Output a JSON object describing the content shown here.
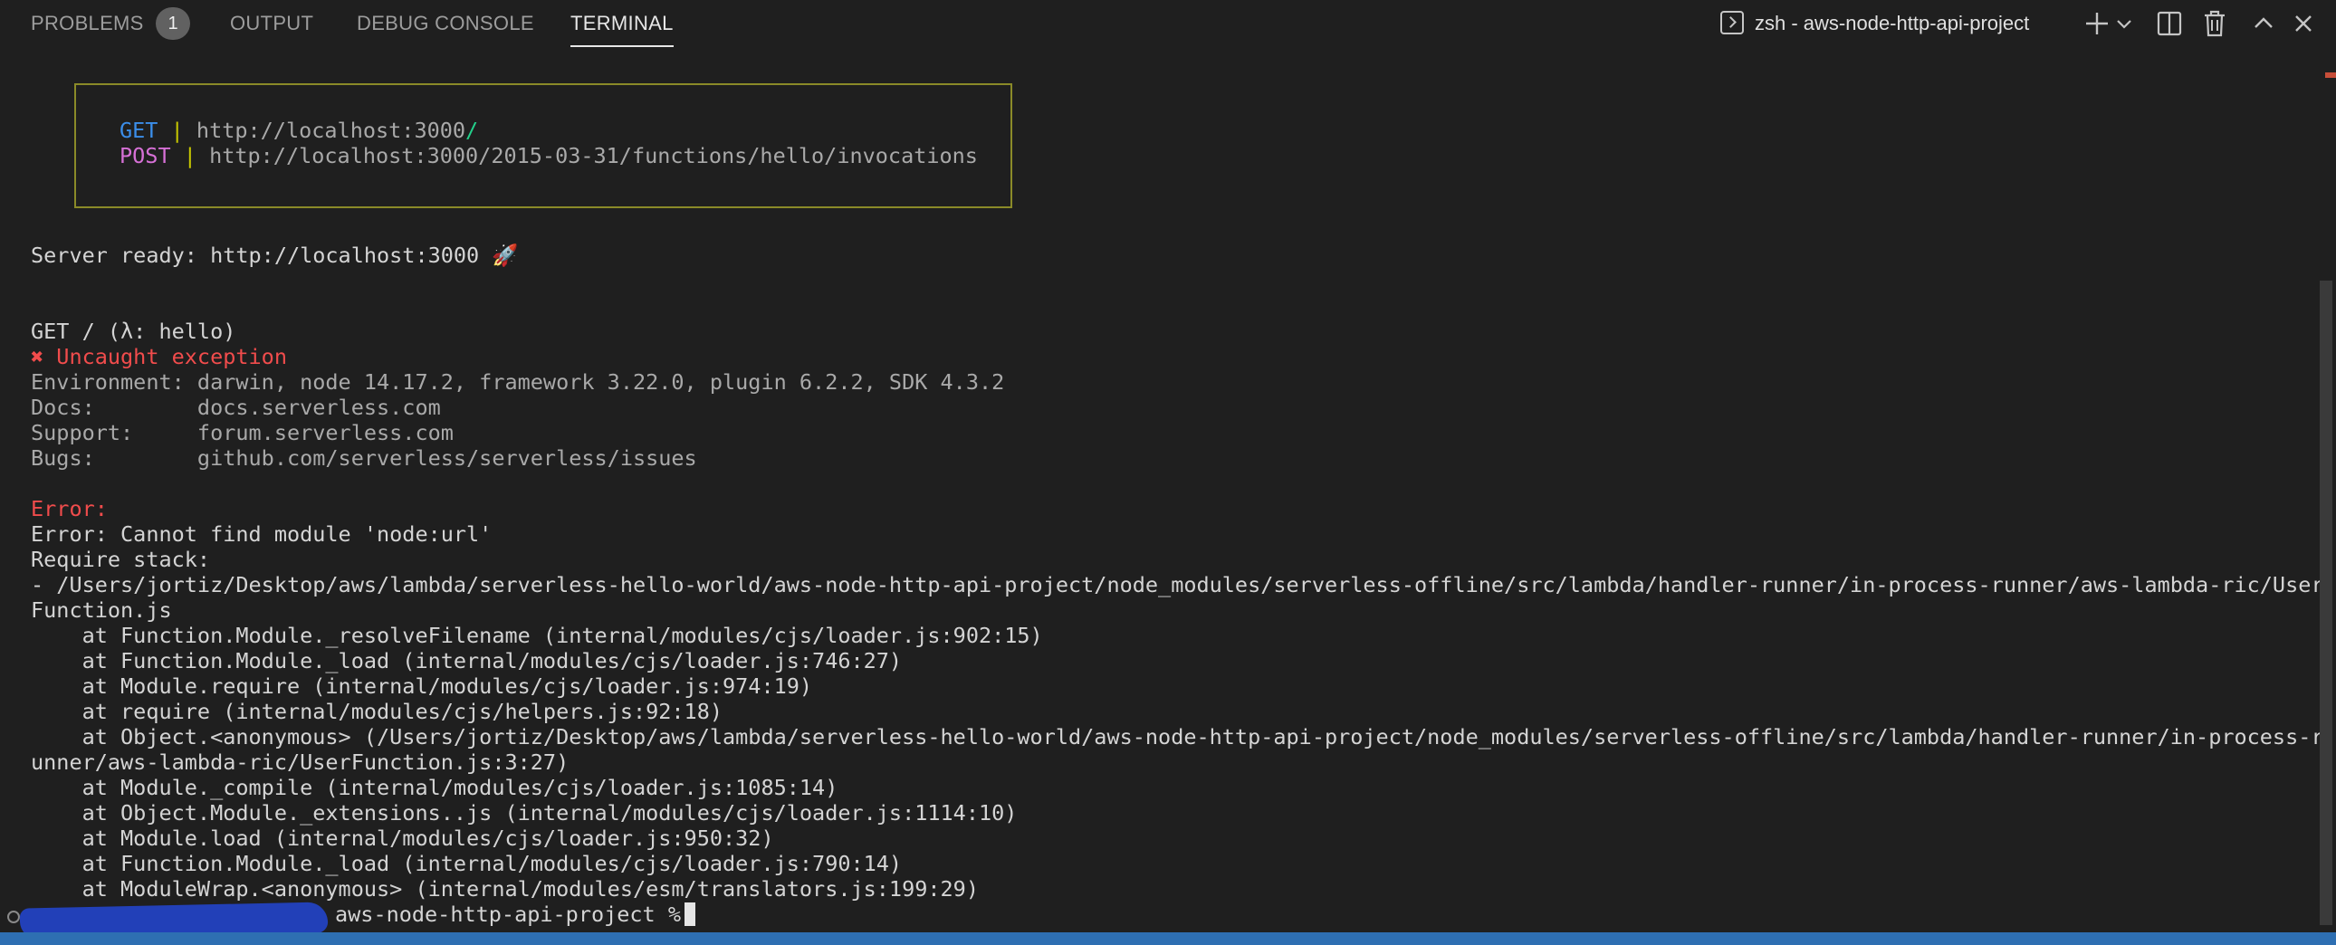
{
  "panel": {
    "tabs": [
      "PROBLEMS",
      "OUTPUT",
      "DEBUG CONSOLE",
      "TERMINAL"
    ],
    "problems_count": "1",
    "terminal_name": "zsh - aws-node-http-api-project"
  },
  "routes": {
    "get_method": "GET",
    "get_url": "http://localhost:3000",
    "get_slash": "/",
    "post_method": "POST",
    "post_url": "http://localhost:3000/2015-03-31/functions/hello/invocations",
    "separator": "|"
  },
  "output": {
    "server_ready": "Server ready: http://localhost:3000 🚀",
    "request": "GET / (λ: hello)",
    "uncaught": "✖ Uncaught exception",
    "environment": "Environment: darwin, node 14.17.2, framework 3.22.0, plugin 6.2.2, SDK 4.3.2",
    "docs": "Docs:        docs.serverless.com",
    "support": "Support:     forum.serverless.com",
    "bugs": "Bugs:        github.com/serverless/serverless/issues",
    "error_label": "Error:",
    "error_msg": "Error: Cannot find module 'node:url'",
    "require_stack": "Require stack:",
    "stack_path_1": "- /Users/jortiz/Desktop/aws/lambda/serverless-hello-world/aws-node-http-api-project/node_modules/serverless-offline/src/lambda/handler-runner/in-process-runner/aws-lambda-ric/User",
    "stack_path_2": "Function.js",
    "trace": [
      "    at Function.Module._resolveFilename (internal/modules/cjs/loader.js:902:15)",
      "    at Function.Module._load (internal/modules/cjs/loader.js:746:27)",
      "    at Module.require (internal/modules/cjs/loader.js:974:19)",
      "    at require (internal/modules/cjs/helpers.js:92:18)",
      "    at Object.<anonymous> (/Users/jortiz/Desktop/aws/lambda/serverless-hello-world/aws-node-http-api-project/node_modules/serverless-offline/src/lambda/handler-runner/in-process-r",
      "unner/aws-lambda-ric/UserFunction.js:3:27)",
      "    at Module._compile (internal/modules/cjs/loader.js:1085:14)",
      "    at Object.Module._extensions..js (internal/modules/cjs/loader.js:1114:10)",
      "    at Module.load (internal/modules/cjs/loader.js:950:32)",
      "    at Function.Module._load (internal/modules/cjs/loader.js:790:14)",
      "    at ModuleWrap.<anonymous> (internal/modules/esm/translators.js:199:29)"
    ],
    "prompt": "aws-node-http-api-project %"
  },
  "icons": [
    "terminal-icon",
    "plus-icon",
    "chevron-down-icon",
    "split-icon",
    "trash-icon",
    "chevron-up-icon",
    "close-icon"
  ],
  "colors": {
    "background": "#1f1f1f",
    "error": "#f14c4c",
    "get": "#3b8eea",
    "post": "#d670d6",
    "box_border": "#8a8a28",
    "status_bar": "#2e6fb2"
  }
}
